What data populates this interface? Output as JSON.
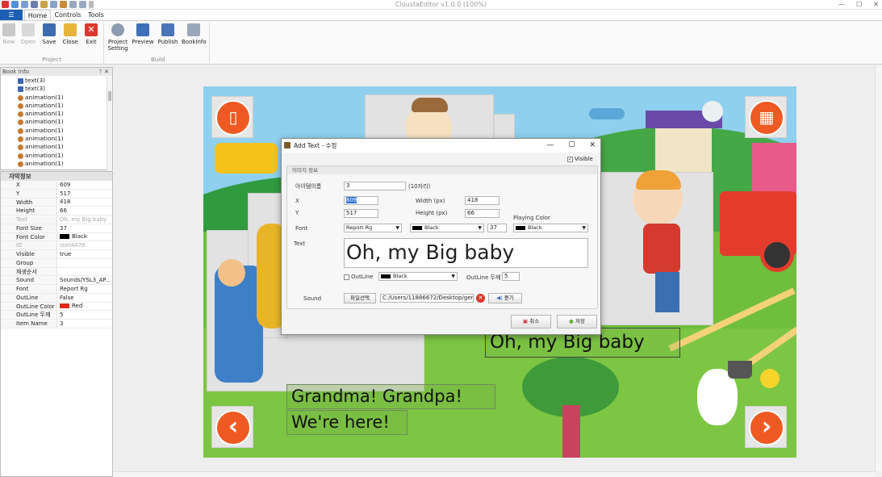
{
  "window": {
    "title": "CloustaEditor v1.0.0 (100%)",
    "controls": [
      "—",
      "☐",
      "✕"
    ]
  },
  "ribbon": {
    "tabs": [
      "Home",
      "Controls",
      "Tools"
    ],
    "buttons": {
      "new": "New",
      "open": "Open",
      "save": "Save",
      "close": "Close",
      "exit": "Exit",
      "project_setting": "Project\nSetting",
      "preview": "Preview",
      "publish": "Publish",
      "bookinfo": "BookInfo"
    },
    "groups": {
      "project": "Project",
      "build": "Build"
    }
  },
  "book_info": {
    "title": "Book Info",
    "items": [
      "text(3)",
      "text(3)",
      "animation(1)",
      "animation(1)",
      "animation(1)",
      "animation(1)",
      "animation(1)",
      "animation(1)",
      "animation(1)",
      "animation(1)",
      "animation(1)"
    ]
  },
  "props": {
    "title": "자막정보",
    "rows": [
      {
        "k": "X",
        "v": "609"
      },
      {
        "k": "Y",
        "v": "517"
      },
      {
        "k": "Width",
        "v": "418"
      },
      {
        "k": "Height",
        "v": "66"
      },
      {
        "k": "Text",
        "v": "Oh, my Big baby"
      },
      {
        "k": "Font Size",
        "v": "37"
      },
      {
        "k": "Font Color",
        "v": "Black"
      },
      {
        "k": "ID",
        "v": "text4476"
      },
      {
        "k": "Visible",
        "v": "true"
      },
      {
        "k": "Group",
        "v": ""
      },
      {
        "k": "재생순서",
        "v": ""
      },
      {
        "k": "Sound",
        "v": "Sounds/YSL3_AP..."
      },
      {
        "k": "Font",
        "v": "Report Rg"
      },
      {
        "k": "OutLine",
        "v": "False"
      },
      {
        "k": "OutLine Color",
        "v": "Red"
      },
      {
        "k": "OutLine 두께",
        "v": "5"
      },
      {
        "k": "Item Name",
        "v": "3"
      }
    ]
  },
  "canvas": {
    "texts": {
      "t1": "Oh, my Big baby",
      "t2": "Grandma! Grandpa!",
      "t3": "We're here!"
    }
  },
  "dialog": {
    "title": "Add Text - 수정",
    "visible_label": "Visible",
    "section": "이미지 정보",
    "item_name_label": "아이템이름",
    "item_name": "3",
    "item_name_hint": "(10자리)",
    "x_label": "X",
    "x": "609",
    "y_label": "Y",
    "y": "517",
    "width_label": "Width (px)",
    "width": "418",
    "height_label": "Height (px)",
    "height": "66",
    "font_label": "Font",
    "font": "Report Rg",
    "font_color": "Black",
    "font_size": "37",
    "playing_color_label": "Playing Color",
    "playing_color": "Black",
    "text_label": "Text",
    "text": "Oh, my Big baby",
    "outline_label": "OutLine",
    "outline_color": "Black",
    "outline_width_label": "OutLine 두께",
    "outline_width": "5",
    "sound_label": "Sound",
    "file_select": "파일선택",
    "sound_path": "C:/Users/11886672/Desktop/gener",
    "listen": "듣기",
    "cancel": "취소",
    "save": "저장"
  }
}
